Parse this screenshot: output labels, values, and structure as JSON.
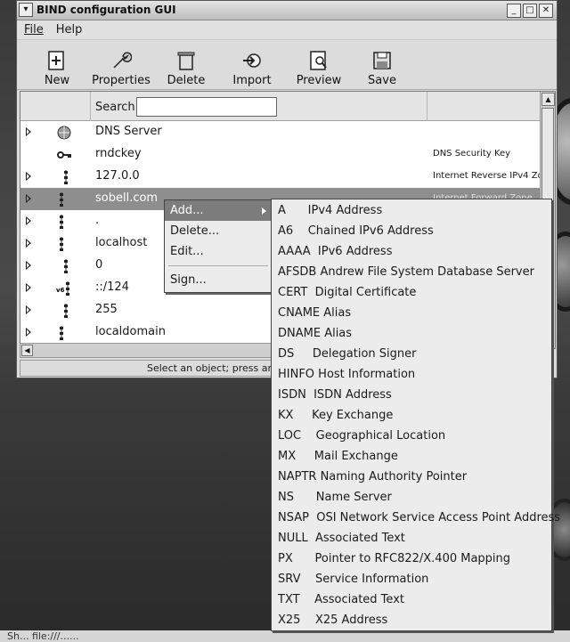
{
  "window": {
    "title": "BIND configuration GUI",
    "menu_button": "▾",
    "minimize": "_",
    "maximize": "□",
    "close": "✕"
  },
  "menubar": {
    "file": "File",
    "help": "Help"
  },
  "toolbar": {
    "new": "New",
    "properties": "Properties",
    "delete": "Delete",
    "import": "Import",
    "preview": "Preview",
    "save": "Save"
  },
  "list": {
    "search_label": "Search:",
    "search_value": "",
    "rows": [
      {
        "label": "DNS Server",
        "type": "",
        "icon": "dns-server-icon",
        "expander": true
      },
      {
        "label": "rndckey",
        "type": "DNS Security Key",
        "icon": "key-icon",
        "expander": false
      },
      {
        "label": "127.0.0",
        "type": "Internet Reverse IPv4 Zone",
        "icon": "reverse-zone-icon",
        "expander": true
      },
      {
        "label": "sobell.com",
        "type": "Internet Forward Zone",
        "icon": "forward-zone-icon",
        "expander": true,
        "selected": true
      },
      {
        "label": ".",
        "type": "",
        "icon": "forward-zone-icon",
        "expander": true
      },
      {
        "label": "localhost",
        "type": "",
        "icon": "forward-zone-icon",
        "expander": true
      },
      {
        "label": "0",
        "type": "",
        "icon": "reverse-zone-icon",
        "expander": true
      },
      {
        "label": "::/124",
        "type": "",
        "icon": "ipv6-zone-icon",
        "expander": true
      },
      {
        "label": "255",
        "type": "",
        "icon": "reverse-zone-icon",
        "expander": true
      },
      {
        "label": "localdomain",
        "type": "",
        "icon": "forward-zone-icon",
        "expander": true
      }
    ]
  },
  "statusbar": {
    "text": "Select an object; press and release"
  },
  "context_menu": {
    "add": "Add...",
    "delete": "Delete...",
    "edit": "Edit...",
    "sign": "Sign..."
  },
  "submenu": [
    "A      IPv4 Address",
    "A6    Chained IPv6 Address",
    "AAAA  IPv6 Address",
    "AFSDB Andrew File System Database Server",
    "CERT  Digital Certificate",
    "CNAME Alias",
    "DNAME Alias",
    "DS     Delegation Signer",
    "HINFO Host Information",
    "ISDN  ISDN Address",
    "KX     Key Exchange",
    "LOC    Geographical Location",
    "MX     Mail Exchange",
    "NAPTR Naming Authority Pointer",
    "NS      Name Server",
    "NSAP  OSI Network Service Access Point Address",
    "NULL  Associated Text",
    "PX      Pointer to RFC822/X.400 Mapping",
    "SRV    Service Information",
    "TXT    Associated Text",
    "X25    X25 Address"
  ],
  "desktop": {
    "bottom_text": "Sh...  file:///...... "
  }
}
